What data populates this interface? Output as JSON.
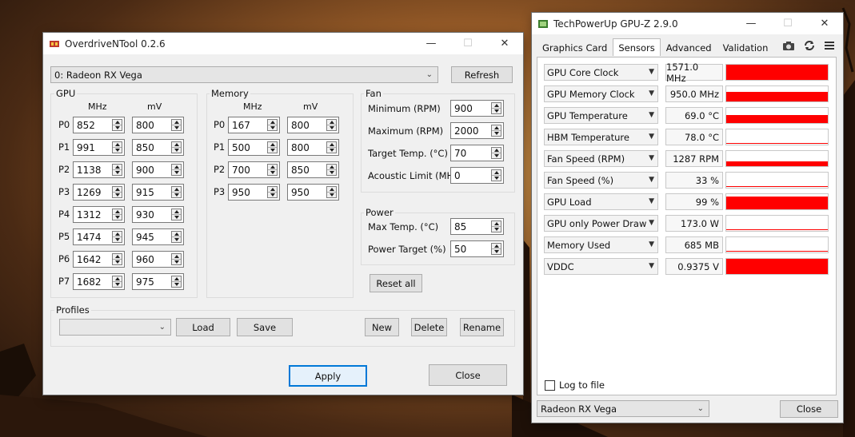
{
  "odnt": {
    "title": "OverdriveNTool 0.2.6",
    "gpu_select": "0: Radeon RX Vega",
    "refresh": "Refresh",
    "gpu_group": "GPU",
    "mem_group": "Memory",
    "col_mhz": "MHz",
    "col_mv": "mV",
    "gpu_states": [
      {
        "label": "P0",
        "mhz": "852",
        "mv": "800"
      },
      {
        "label": "P1",
        "mhz": "991",
        "mv": "850"
      },
      {
        "label": "P2",
        "mhz": "1138",
        "mv": "900"
      },
      {
        "label": "P3",
        "mhz": "1269",
        "mv": "915"
      },
      {
        "label": "P4",
        "mhz": "1312",
        "mv": "930"
      },
      {
        "label": "P5",
        "mhz": "1474",
        "mv": "945"
      },
      {
        "label": "P6",
        "mhz": "1642",
        "mv": "960"
      },
      {
        "label": "P7",
        "mhz": "1682",
        "mv": "975"
      }
    ],
    "mem_states": [
      {
        "label": "P0",
        "mhz": "167",
        "mv": "800"
      },
      {
        "label": "P1",
        "mhz": "500",
        "mv": "800"
      },
      {
        "label": "P2",
        "mhz": "700",
        "mv": "850"
      },
      {
        "label": "P3",
        "mhz": "950",
        "mv": "950"
      }
    ],
    "fan_group": "Fan",
    "fan": [
      {
        "label": "Minimum (RPM)",
        "value": "900"
      },
      {
        "label": "Maximum (RPM)",
        "value": "2000"
      },
      {
        "label": "Target Temp. (°C)",
        "value": "70"
      },
      {
        "label": "Acoustic Limit (MHz)",
        "value": "0"
      }
    ],
    "power_group": "Power",
    "power": [
      {
        "label": "Max Temp. (°C)",
        "value": "85"
      },
      {
        "label": "Power Target (%)",
        "value": "50"
      }
    ],
    "reset_all": "Reset all",
    "profiles_group": "Profiles",
    "profile_select": "",
    "load": "Load",
    "save": "Save",
    "new": "New",
    "delete": "Delete",
    "rename": "Rename",
    "apply": "Apply",
    "close": "Close"
  },
  "gpuz": {
    "title": "TechPowerUp GPU-Z 2.9.0",
    "tabs": [
      "Graphics Card",
      "Sensors",
      "Advanced",
      "Validation"
    ],
    "active_tab": "Sensors",
    "sensors": [
      {
        "name": "GPU Core Clock",
        "value": "1571.0 MHz",
        "level": 1.0
      },
      {
        "name": "GPU Memory Clock",
        "value": "950.0 MHz",
        "level": 0.65
      },
      {
        "name": "GPU Temperature",
        "value": "69.0 °C",
        "level": 0.5
      },
      {
        "name": "HBM Temperature",
        "value": "78.0 °C",
        "level": 0.0
      },
      {
        "name": "Fan Speed (RPM)",
        "value": "1287 RPM",
        "level": 0.3
      },
      {
        "name": "Fan Speed (%)",
        "value": "33 %",
        "level": 0.0
      },
      {
        "name": "GPU Load",
        "value": "99 %",
        "level": 0.85
      },
      {
        "name": "GPU only Power Draw",
        "value": "173.0 W",
        "level": 0.0
      },
      {
        "name": "Memory Used",
        "value": "685 MB",
        "level": 0.0
      },
      {
        "name": "VDDC",
        "value": "0.9375 V",
        "level": 1.0
      }
    ],
    "log_to_file": "Log to file",
    "device_select": "Radeon RX Vega",
    "close": "Close"
  },
  "colors": {
    "graph": "#ff0000",
    "accent": "#0078d7"
  }
}
